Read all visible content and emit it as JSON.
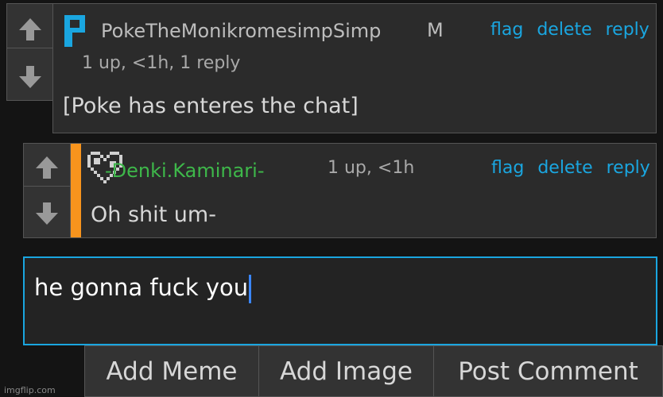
{
  "comments": [
    {
      "username": "PokeTheMonikromesimpSimp",
      "badge": "M",
      "meta": "1 up, <1h, 1 reply",
      "text": "[Poke has enteres the chat]",
      "actions": [
        "flag",
        "delete",
        "reply"
      ],
      "username_color": "#bdbdbd"
    },
    {
      "username": "-Denki.Kaminari-",
      "meta": "1 up, <1h",
      "text": "Oh shit um-",
      "actions": [
        "flag",
        "delete",
        "reply"
      ],
      "username_color": "#3eb84a",
      "accent_color": "#f7941d"
    }
  ],
  "reply_input": {
    "value": "he gonna fuck you"
  },
  "buttons": {
    "add_meme": "Add Meme",
    "add_image": "Add Image",
    "post_comment": "Post Comment"
  },
  "watermark": "imgflip.com",
  "colors": {
    "link": "#1aa6e0",
    "input_border": "#1aa6e0"
  }
}
